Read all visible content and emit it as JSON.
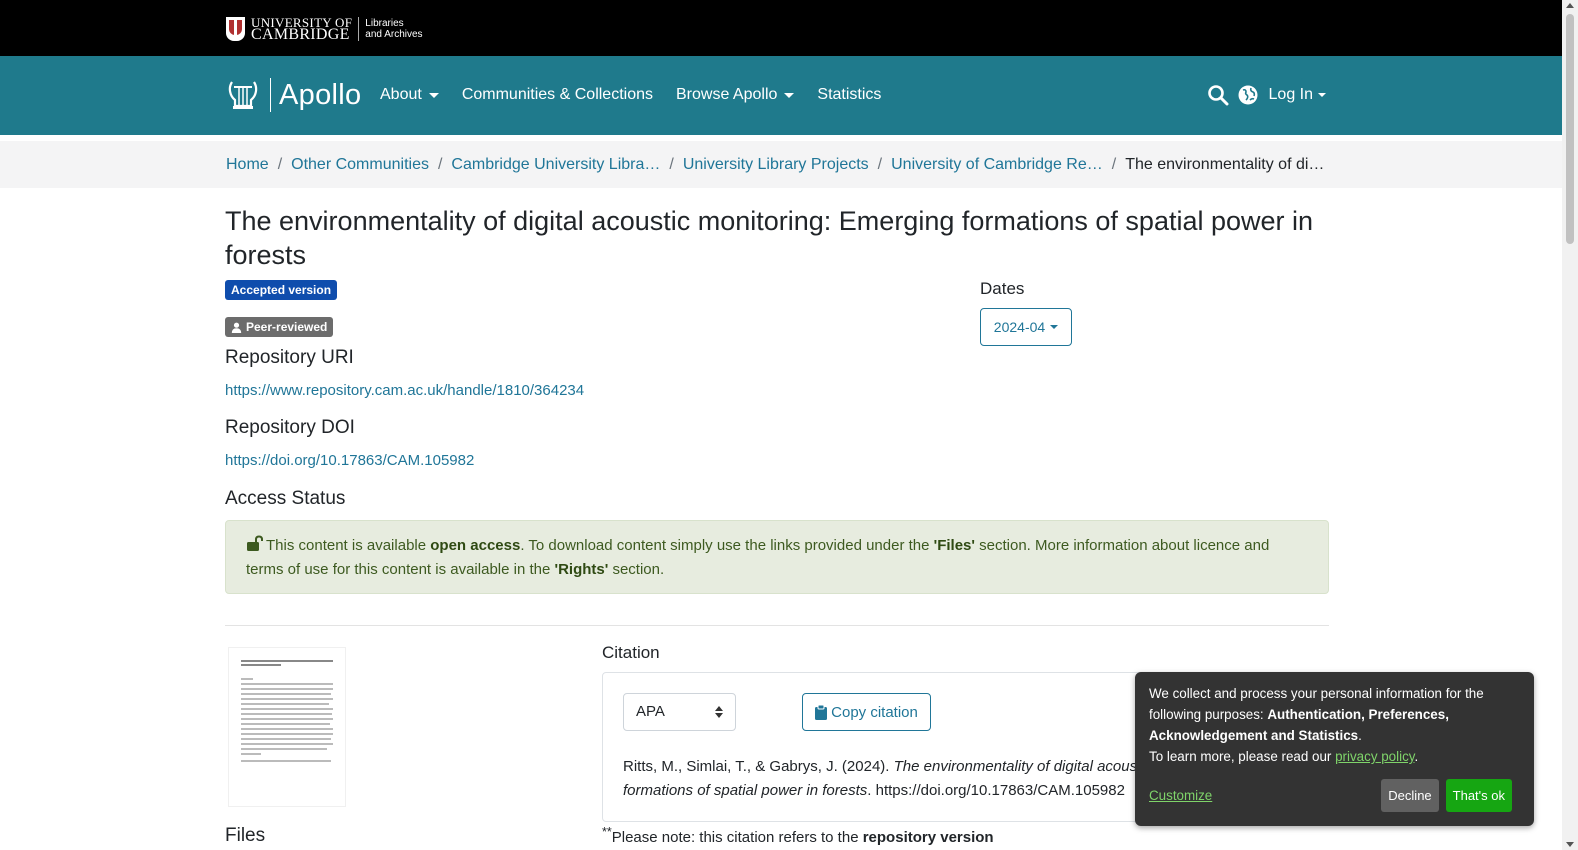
{
  "topbar": {
    "university_line1": "UNIVERSITY OF",
    "university_line2": "CAMBRIDGE",
    "sub_line1": "Libraries",
    "sub_line2": "and Archives"
  },
  "navbar": {
    "brand": "Apollo",
    "items": [
      {
        "label": "About",
        "dropdown": true
      },
      {
        "label": "Communities & Collections",
        "dropdown": false
      },
      {
        "label": "Browse Apollo",
        "dropdown": true
      },
      {
        "label": "Statistics",
        "dropdown": false
      }
    ],
    "login": "Log In",
    "icons": [
      "search-icon",
      "globe-icon"
    ]
  },
  "breadcrumb": {
    "items": [
      "Home",
      "Other Communities",
      "Cambridge University Libra…",
      "University Library Projects",
      "University of Cambridge Re…"
    ],
    "current": "The environmentality of di…"
  },
  "item": {
    "title": "The environmentality of digital acoustic monitoring: Emerging formations of spatial power in forests",
    "badge_version": "Accepted version",
    "badge_peer": "Peer-reviewed",
    "repo_uri_heading": "Repository URI",
    "repo_uri": "https://www.repository.cam.ac.uk/handle/1810/364234",
    "repo_doi_heading": "Repository DOI",
    "repo_doi": "https://doi.org/10.17863/CAM.105982",
    "access_heading": "Access Status",
    "dates_label": "Dates",
    "dates_value": "2024-04",
    "files_heading": "Files"
  },
  "access": {
    "t1": "This content is available ",
    "t2": "open access",
    "t3": ". To download content simply use the links provided under the ",
    "t4": "'Files'",
    "t5": " section. More information about licence and terms of use for this content is available in the ",
    "t6": "'Rights'",
    "t7": " section."
  },
  "citation": {
    "heading": "Citation",
    "style": "APA",
    "copy_label": "Copy citation",
    "authors": "Ritts, M., Simlai, T., & Gabrys, J. (2024). ",
    "title_italic_1": "The environmentality of digital acoustic m",
    "title_italic_2": "formations of spatial power in forests",
    "doi": ". https://doi.org/10.17863/CAM.105982",
    "note_prefix": "**",
    "note_text": "Please note: this citation refers to the ",
    "note_bold": "repository version"
  },
  "cookie": {
    "text1": "We collect and process your personal information for the following purposes: ",
    "purposes": "Authentication, Preferences, Acknowledgement and Statistics",
    "text_period": ".",
    "text2": "To learn more, please read our ",
    "privacy_link": "privacy policy",
    "customize": "Customize",
    "decline": "Decline",
    "accept": "That's ok"
  }
}
